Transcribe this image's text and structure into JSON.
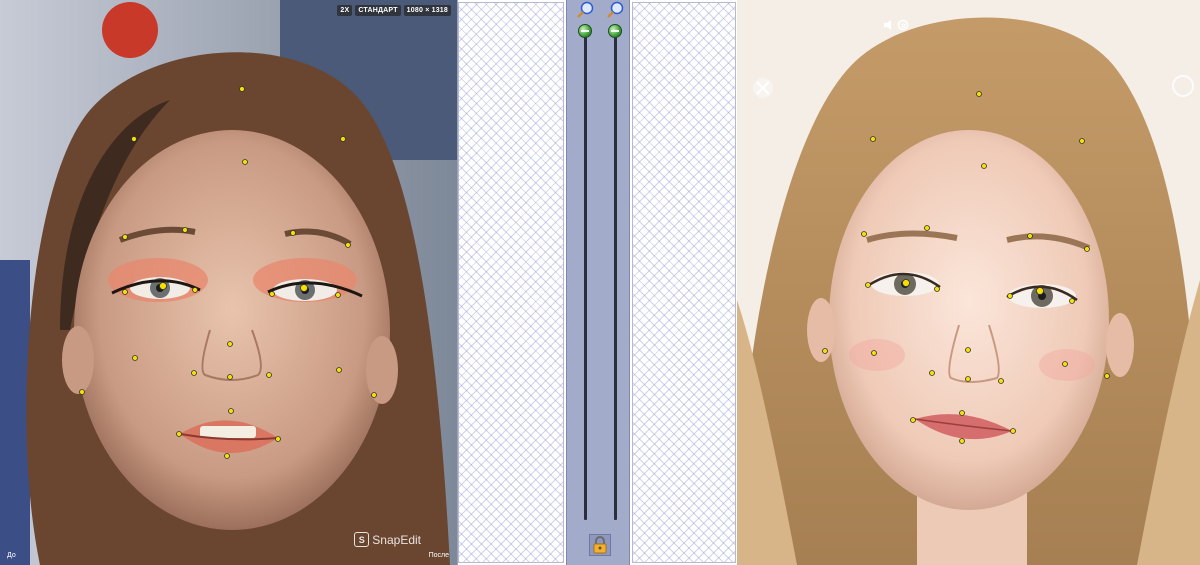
{
  "left_image": {
    "badges": [
      "2X",
      "СТАНДАРТ",
      "1080 × 1318"
    ],
    "label_before": "До",
    "label_after": "После",
    "watermark": "SnapEdit",
    "logo_letter": "S"
  },
  "center_panel": {
    "icons": [
      "zoom-in-icon",
      "zoom-out-icon",
      "lock-icon"
    ],
    "accent": "#a3abcb",
    "slider_left_level": 0.0,
    "slider_right_level": 0.0
  },
  "right_image": {
    "icons": [
      "close-icon",
      "speaker-icon",
      "threads-icon"
    ]
  },
  "landmark_color": "#f5e000"
}
